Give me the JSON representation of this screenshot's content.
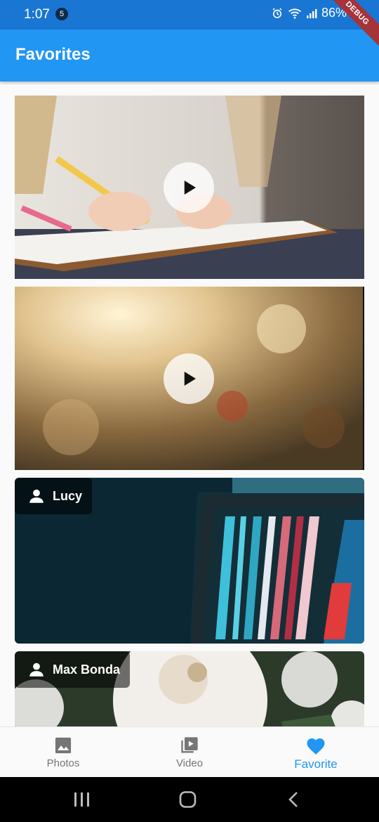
{
  "status_bar": {
    "time": "1:07",
    "notification_count": "5",
    "battery": "86%",
    "icons": [
      "alarm-icon",
      "wifi-icon",
      "signal-icon"
    ]
  },
  "debug_banner": "DEBUG",
  "app_bar": {
    "title": "Favorites"
  },
  "feed": {
    "items": [
      {
        "type": "video",
        "icon": "play-icon"
      },
      {
        "type": "video",
        "icon": "play-icon"
      },
      {
        "type": "photo",
        "author": "Lucy",
        "icon": "person-icon"
      },
      {
        "type": "photo",
        "author": "Max Bonda",
        "icon": "person-icon"
      }
    ]
  },
  "bottom_nav": {
    "items": [
      {
        "label": "Photos",
        "icon": "image-icon",
        "active": false
      },
      {
        "label": "Video",
        "icon": "video-library-icon",
        "active": false
      },
      {
        "label": "Favorite",
        "icon": "heart-icon",
        "active": true
      }
    ]
  },
  "colors": {
    "status_bar": "#1976d2",
    "app_bar": "#2196f3",
    "accent": "#2196f3",
    "inactive": "#757575"
  },
  "system_nav": {
    "icons": [
      "recents-icon",
      "home-icon",
      "back-icon"
    ]
  }
}
